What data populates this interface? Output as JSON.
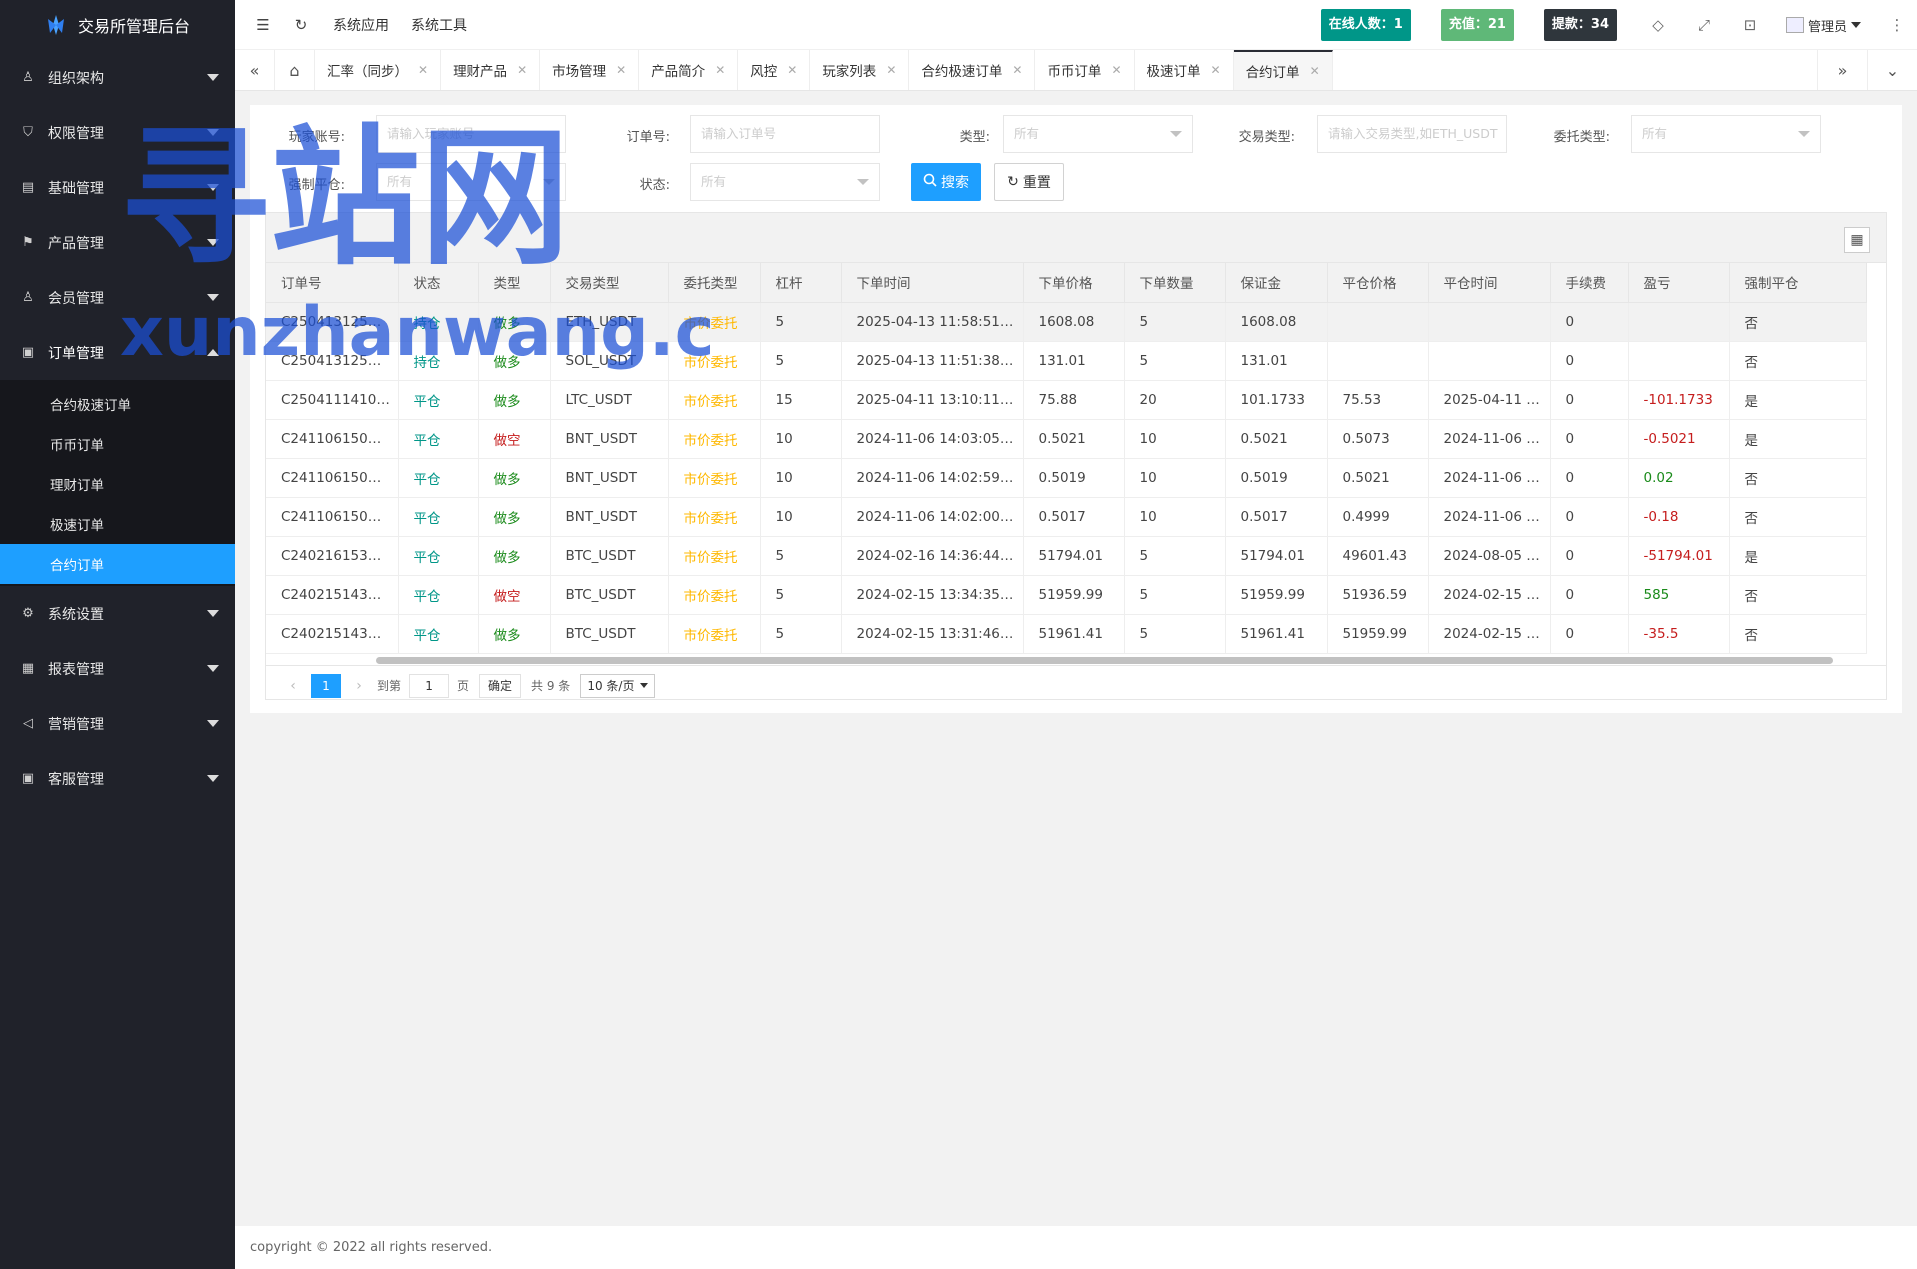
{
  "app": {
    "title": "交易所管理后台"
  },
  "sidebar": {
    "items": [
      {
        "label": "组织架构",
        "icon": "user-icon"
      },
      {
        "label": "权限管理",
        "icon": "shield-icon"
      },
      {
        "label": "基础管理",
        "icon": "cards-icon"
      },
      {
        "label": "产品管理",
        "icon": "flag-icon"
      },
      {
        "label": "会员管理",
        "icon": "user-icon"
      },
      {
        "label": "订单管理",
        "icon": "apps-icon"
      }
    ],
    "submenu": [
      "合约极速订单",
      "币币订单",
      "理财订单",
      "极速订单",
      "合约订单"
    ],
    "items_after": [
      {
        "label": "系统设置",
        "icon": "gear-icon"
      },
      {
        "label": "报表管理",
        "icon": "grid-icon"
      },
      {
        "label": "营销管理",
        "icon": "speaker-icon"
      },
      {
        "label": "客服管理",
        "icon": "apps-icon"
      }
    ]
  },
  "topbar": {
    "links": [
      "系统应用",
      "系统工具"
    ],
    "badges": [
      {
        "text": "在线人数：1",
        "color": "#009688"
      },
      {
        "text": "充值：21",
        "color": "#5fb878"
      },
      {
        "text": "提款：34",
        "color": "#2f363c"
      }
    ],
    "user": "管理员"
  },
  "tabs": [
    "汇率（同步）",
    "理财产品",
    "市场管理",
    "产品简介",
    "风控",
    "玩家列表",
    "合约极速订单",
    "币币订单",
    "极速订单",
    "合约订单"
  ],
  "filters": {
    "player_label": "玩家账号:",
    "player_placeholder": "请输入玩家账号",
    "order_label": "订单号:",
    "order_placeholder": "请输入订单号",
    "type_label": "类型:",
    "type_value": "所有",
    "trade_label": "交易类型:",
    "trade_placeholder": "请输入交易类型,如ETH_USDT",
    "entrust_label": "委托类型:",
    "entrust_value": "所有",
    "force_label": "强制平仓:",
    "force_value": "所有",
    "status_label": "状态:",
    "status_value": "所有",
    "search_btn": "搜索",
    "reset_btn": "重置"
  },
  "table": {
    "headers": [
      "订单号",
      "状态",
      "类型",
      "交易类型",
      "委托类型",
      "杠杆",
      "下单时间",
      "下单价格",
      "下单数量",
      "保证金",
      "平仓价格",
      "平仓时间",
      "手续费",
      "盈亏",
      "强制平仓"
    ],
    "rows": [
      [
        "C250413125…",
        "持仓",
        "做多",
        "ETH_USDT",
        "市价委托",
        "5",
        "2025-04-13 11:58:51…",
        "1608.08",
        "5",
        "1608.08",
        "",
        "",
        "0",
        "",
        "否"
      ],
      [
        "C250413125…",
        "持仓",
        "做多",
        "SOL_USDT",
        "市价委托",
        "5",
        "2025-04-13 11:51:38…",
        "131.01",
        "5",
        "131.01",
        "",
        "",
        "0",
        "",
        "否"
      ],
      [
        "C2504111410…",
        "平仓",
        "做多",
        "LTC_USDT",
        "市价委托",
        "15",
        "2025-04-11 13:10:11…",
        "75.88",
        "20",
        "101.1733",
        "75.53",
        "2025-04-11 …",
        "0",
        "-101.1733",
        "是"
      ],
      [
        "C241106150…",
        "平仓",
        "做空",
        "BNT_USDT",
        "市价委托",
        "10",
        "2024-11-06 14:03:05…",
        "0.5021",
        "10",
        "0.5021",
        "0.5073",
        "2024-11-06 …",
        "0",
        "-0.5021",
        "是"
      ],
      [
        "C241106150…",
        "平仓",
        "做多",
        "BNT_USDT",
        "市价委托",
        "10",
        "2024-11-06 14:02:59…",
        "0.5019",
        "10",
        "0.5019",
        "0.5021",
        "2024-11-06 …",
        "0",
        "0.02",
        "否"
      ],
      [
        "C241106150…",
        "平仓",
        "做多",
        "BNT_USDT",
        "市价委托",
        "10",
        "2024-11-06 14:02:00…",
        "0.5017",
        "10",
        "0.5017",
        "0.4999",
        "2024-11-06 …",
        "0",
        "-0.18",
        "否"
      ],
      [
        "C240216153…",
        "平仓",
        "做多",
        "BTC_USDT",
        "市价委托",
        "5",
        "2024-02-16 14:36:44…",
        "51794.01",
        "5",
        "51794.01",
        "49601.43",
        "2024-08-05 …",
        "0",
        "-51794.01",
        "是"
      ],
      [
        "C240215143…",
        "平仓",
        "做空",
        "BTC_USDT",
        "市价委托",
        "5",
        "2024-02-15 13:34:35…",
        "51959.99",
        "5",
        "51959.99",
        "51936.59",
        "2024-02-15 …",
        "0",
        "585",
        "否"
      ],
      [
        "C240215143…",
        "平仓",
        "做多",
        "BTC_USDT",
        "市价委托",
        "5",
        "2024-02-15 13:31:46…",
        "51961.41",
        "5",
        "51961.41",
        "51959.99",
        "2024-02-15 …",
        "0",
        "-35.5",
        "否"
      ]
    ]
  },
  "pager": {
    "current": "1",
    "goto": "到第",
    "page_input": "1",
    "page_unit": "页",
    "ok": "确定",
    "total": "共 9 条",
    "size": "10 条/页"
  },
  "footer": "copyright © 2022 all rights reserved.",
  "watermark": {
    "line1": "寻站网",
    "line2": "xunzhanwang.com"
  }
}
